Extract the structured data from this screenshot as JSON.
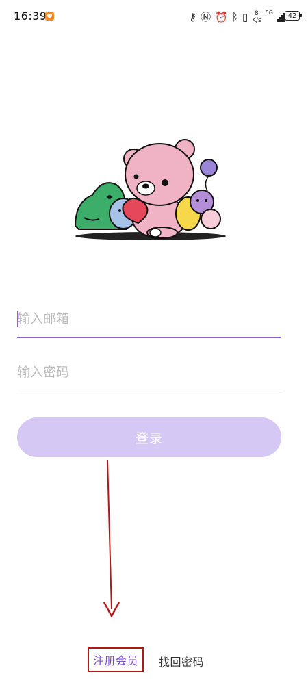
{
  "status_bar": {
    "time": "16:39",
    "network_speed_value": "8",
    "network_speed_unit": "K/s",
    "network_type": "5G",
    "battery": "42",
    "icons": [
      "app-notification-icon",
      "key-icon",
      "nfc-icon",
      "alarm-icon",
      "bluetooth-icon",
      "vibrate-icon",
      "signal-icon",
      "battery-icon"
    ]
  },
  "login": {
    "email_placeholder": "输入邮箱",
    "password_placeholder": "输入密码",
    "login_button": "登录"
  },
  "footer": {
    "register": "注册会员",
    "recover_password": "找回密码"
  },
  "colors": {
    "accent": "#8b5fcf",
    "button_bg": "#d6c8f4",
    "register_text": "#7a4ed0",
    "annotation_red": "#b01818"
  }
}
